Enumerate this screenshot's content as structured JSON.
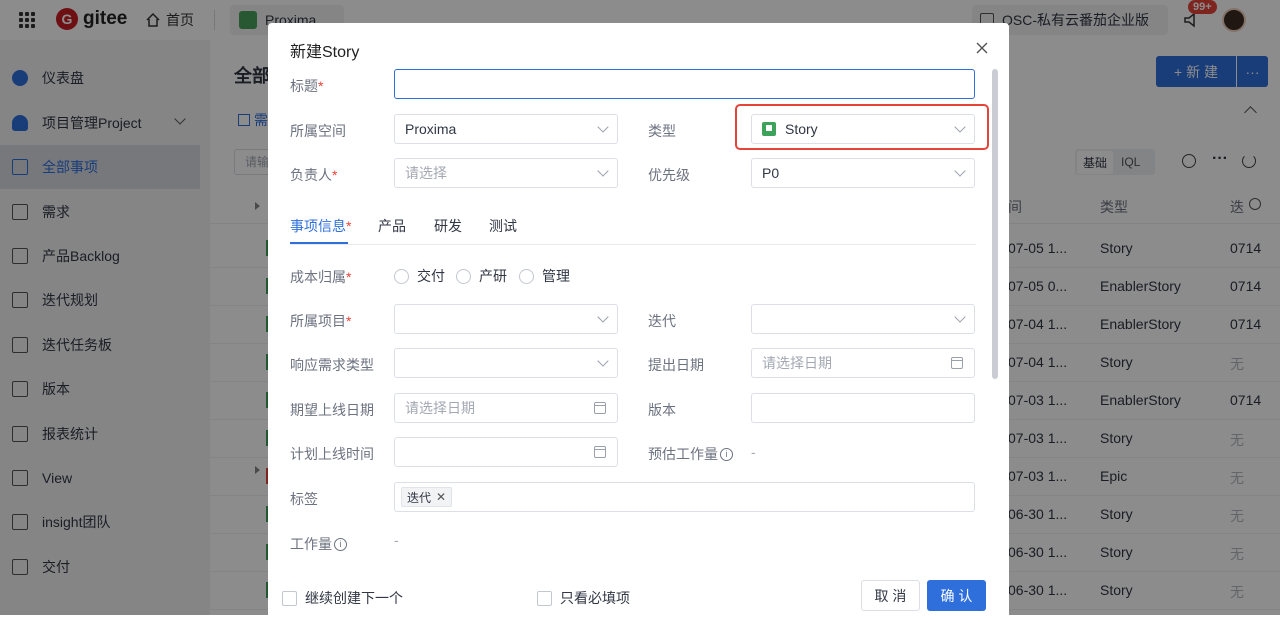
{
  "topbar": {
    "logo_text": "gitee",
    "home": "首页",
    "project": "Proxima",
    "org": "OSC-私有云番茄企业版",
    "badge": "99+"
  },
  "sidebar": {
    "items": [
      {
        "label": "仪表盘"
      },
      {
        "label": "项目管理Project"
      },
      {
        "label": "全部事项"
      },
      {
        "label": "需求"
      },
      {
        "label": "产品Backlog"
      },
      {
        "label": "迭代规划"
      },
      {
        "label": "迭代任务板"
      },
      {
        "label": "版本"
      },
      {
        "label": "报表统计"
      },
      {
        "label": "View"
      },
      {
        "label": "insight团队"
      },
      {
        "label": "交付"
      }
    ]
  },
  "main": {
    "title": "全部",
    "new_button": "+ 新 建",
    "more": "···",
    "tab_partial": "需",
    "search_partial": "请输",
    "mode_basic": "基础",
    "mode_iql": "IQL",
    "col_time": "间",
    "col_type": "类型",
    "col_iter": "迭",
    "rows": [
      {
        "time": "07-05 1...",
        "type": "Story",
        "iter": "0714"
      },
      {
        "time": "07-05 0...",
        "type": "EnablerStory",
        "iter": "0714"
      },
      {
        "time": "07-04 1...",
        "type": "EnablerStory",
        "iter": "0714"
      },
      {
        "time": "07-04 1...",
        "type": "Story",
        "iter": "无"
      },
      {
        "time": "07-03 1...",
        "type": "EnablerStory",
        "iter": "0714"
      },
      {
        "time": "07-03 1...",
        "type": "Story",
        "iter": "无"
      },
      {
        "time": "07-03 1...",
        "type": "Epic",
        "iter": "无"
      },
      {
        "time": "06-30 1...",
        "type": "Story",
        "iter": "无"
      },
      {
        "time": "06-30 1...",
        "type": "Story",
        "iter": "无"
      },
      {
        "time": "06-30 1...",
        "type": "Story",
        "iter": "无"
      }
    ]
  },
  "modal": {
    "title": "新建Story",
    "labels": {
      "title": "标题",
      "space": "所属空间",
      "type": "类型",
      "assignee": "负责人",
      "priority": "优先级",
      "cost": "成本归属",
      "project": "所属项目",
      "iteration": "迭代",
      "resp_type": "响应需求类型",
      "propose_date": "提出日期",
      "expect_date": "期望上线日期",
      "version": "版本",
      "plan_time": "计划上线时间",
      "estimate": "预估工作量",
      "tags": "标签",
      "workload": "工作量"
    },
    "values": {
      "title": "",
      "space": "Proxima",
      "type": "Story",
      "assignee_placeholder": "请选择",
      "priority": "P0",
      "date_placeholder": "请选择日期",
      "estimate": "-",
      "workload": "-",
      "tag": "迭代"
    },
    "tabs": [
      "事项信息",
      "产品",
      "研发",
      "测试"
    ],
    "cost_options": [
      "交付",
      "产研",
      "管理"
    ],
    "footer": {
      "continue": "继续创建下一个",
      "required_only": "只看必填项",
      "cancel": "取 消",
      "confirm": "确 认"
    }
  }
}
